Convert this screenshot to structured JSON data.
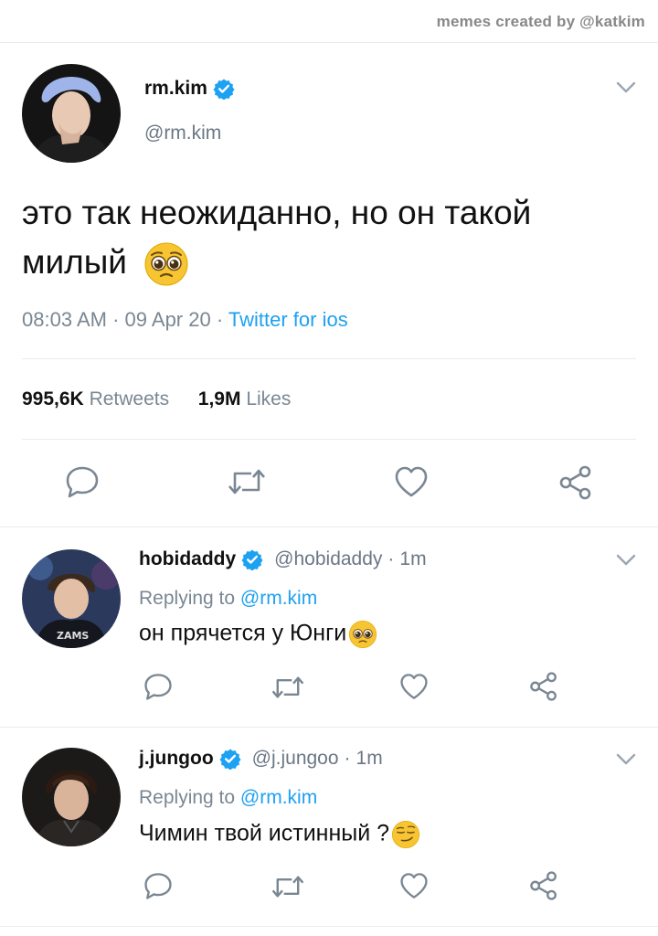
{
  "credit": "memes created by @katkim",
  "main_tweet": {
    "name": "rm.kim",
    "handle": "@rm.kim",
    "text": "это так неожиданно, но он такой милый",
    "emoji": "pleading-face",
    "time": "08:03 AM",
    "date": "09 Apr 20",
    "source": "Twitter for ios",
    "retweets_count": "995,6K",
    "retweets_label": "Retweets",
    "likes_count": "1,9M",
    "likes_label": "Likes"
  },
  "replies": [
    {
      "name": "hobidaddy",
      "handle": "@hobidaddy",
      "time": "1m",
      "replying_prefix": "Replying to",
      "replying_to": "@rm.kim",
      "text": "он прячется у Юнги",
      "emoji": "pleading-face"
    },
    {
      "name": "j.jungoo",
      "handle": "@j.jungoo",
      "time": "1m",
      "replying_prefix": "Replying to",
      "replying_to": "@rm.kim",
      "text": "Чимин твой истинный ?",
      "emoji": "smirking-face"
    }
  ],
  "icons": [
    "verified-badge-icon",
    "chevron-down-icon",
    "reply-icon",
    "retweet-icon",
    "like-icon",
    "share-icon"
  ],
  "colors": {
    "accent": "#1da1f2",
    "muted": "#7a8793",
    "divider": "#e6ecf0"
  }
}
